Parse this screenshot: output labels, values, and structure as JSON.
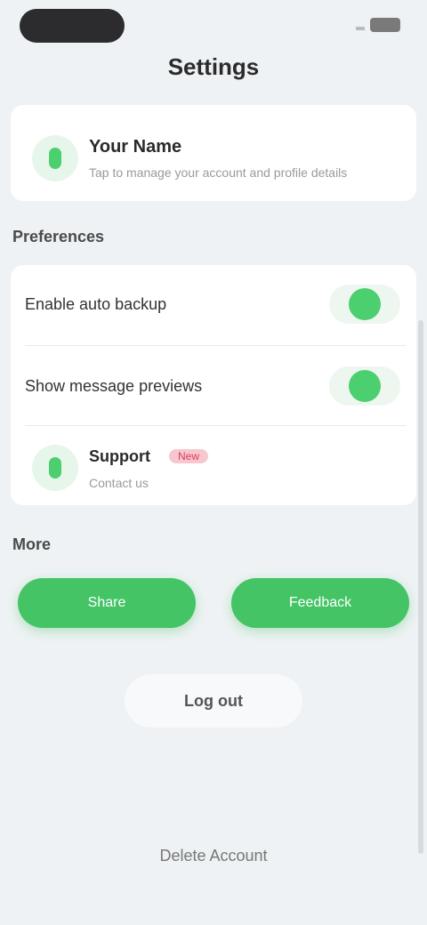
{
  "header": {
    "title": "Settings"
  },
  "account": {
    "name": "Your Name",
    "subtitle": "Tap to manage your account and profile details",
    "icon": "phone-icon"
  },
  "sections": {
    "preferences": "Preferences",
    "more": "More"
  },
  "settings": {
    "row1_label": "Enable auto backup",
    "row1_on": true,
    "row2_label": "Show message previews",
    "row2_on": true,
    "chat_name": "Support",
    "chat_badge": "New",
    "chat_sub": "Contact us",
    "chat_icon": "phone-icon"
  },
  "buttons": {
    "left": "Share",
    "right": "Feedback",
    "logout": "Log out"
  },
  "footer": {
    "link": "Delete Account"
  },
  "colors": {
    "accent": "#44c465",
    "badge_bg": "#f6c7cf",
    "badge_text": "#e23b55"
  }
}
